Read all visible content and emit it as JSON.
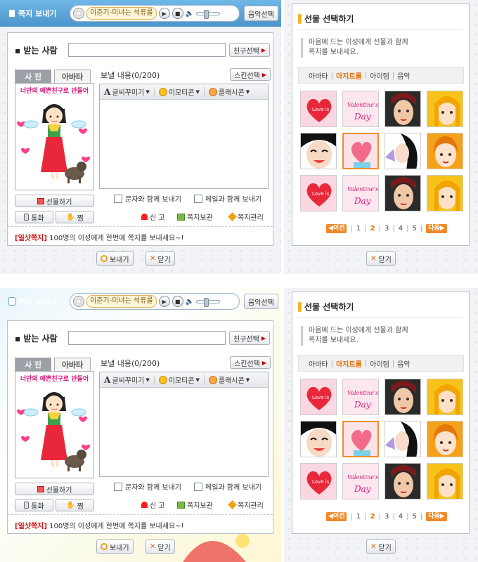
{
  "header": {
    "title": "쪽지 보내기",
    "song": "이준기-미녀는 석류를",
    "music_select": "음악선택"
  },
  "form": {
    "recipient_label": "받는 사람",
    "recipient_value": "",
    "friend_select": "친구선택",
    "tab_photo": "사 진",
    "tab_avatar": "아바타",
    "avatar_caption": "너만의 예쁜친구로 만들어",
    "gift_button": "선물하기",
    "call_button": "통화",
    "poke_button": "찜",
    "content_label": "보낼 내용(0/200)",
    "skin_select": "스킨선택",
    "toolbar": {
      "font": "글씨꾸미기",
      "emoticon": "이모티콘",
      "flashcon": "플래시콘"
    },
    "message_value": "",
    "with_sms": "문자와 함께 보내기",
    "with_mail": "메일과 함께 보내기",
    "report": "신 고",
    "archive": "쪽지보관",
    "manage": "쪽지관리",
    "promo_tag": "[일샷쪽지]",
    "promo_text": "100명의 이성에게 한번에 쪽지를 보내세요~!"
  },
  "footer": {
    "send": "보내기",
    "close": "닫기"
  },
  "gift": {
    "title": "선물 선택하기",
    "desc_line1": "마음에 드는 이성에게 선물과 함께",
    "desc_line2": "쪽지를 보내세요.",
    "categories": [
      "아바타",
      "아지트룸",
      "아이템",
      "음악"
    ],
    "active_category": "아지트룸",
    "thumbs": [
      "heart-love",
      "valentines-day",
      "girl-face-dark",
      "girl-face-blonde",
      "girl-face-smile",
      "heart-card",
      "girl-purple",
      "girl-face-orange",
      "heart-love",
      "valentines-day",
      "girl-face-dark",
      "girl-face-blonde"
    ],
    "selected_index": 5,
    "prev": "이전",
    "next": "다음",
    "pages": [
      "1",
      "2",
      "3",
      "4",
      "5"
    ],
    "current_page": "2",
    "close": "닫기"
  },
  "colors": {
    "accent": "#ea6e00",
    "header_blue": "#4b95cc",
    "promo_red": "#cc1111"
  }
}
